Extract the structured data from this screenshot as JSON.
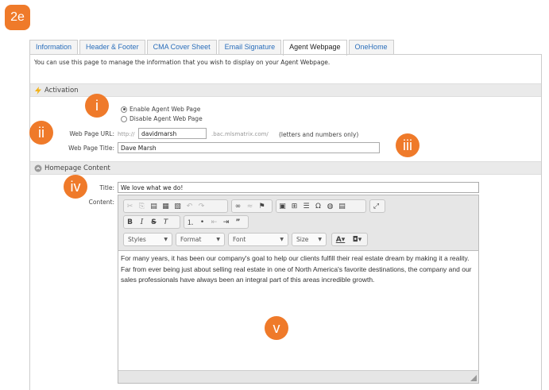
{
  "badges": {
    "main": "2e",
    "i": "i",
    "ii": "ii",
    "iii": "iii",
    "iv": "iv",
    "v": "v"
  },
  "tabs": [
    {
      "label": "Information"
    },
    {
      "label": "Header & Footer"
    },
    {
      "label": "CMA Cover Sheet"
    },
    {
      "label": "Email Signature"
    },
    {
      "label": "Agent Webpage"
    },
    {
      "label": "OneHome"
    }
  ],
  "active_tab": "Agent Webpage",
  "intro": "You can use this page to manage the information that you wish to display on your Agent Webpage.",
  "activation": {
    "title": "Activation",
    "enable_label": "Enable Agent Web Page",
    "disable_label": "Disable Agent Web Page",
    "url_label": "Web Page URL:",
    "url_prefix": "http://",
    "url_value": "davidmarsh",
    "url_suffix": ".bac.mlsmatrix.com/",
    "url_note": "(letters and numbers only)",
    "page_title_label": "Web Page Title:",
    "page_title_value": "Dave Marsh"
  },
  "homepage": {
    "title": "Homepage Content",
    "title_label": "Title:",
    "title_value": "We love what we do!",
    "content_label": "Content:",
    "styles": "Styles",
    "format": "Format",
    "font": "Font",
    "size": "Size",
    "content": "For many years, it has been our company's goal to help our clients fulfill their real estate dream by making it a reality. Far from ever being just about selling real estate in one of North America's favorite destinations, the company and our sales professionals have always been an integral part of this areas incredible growth."
  },
  "colors": {
    "badge": "#ef7a2a",
    "tab_link": "#2a6ebb",
    "section_bg": "#eaeaea"
  }
}
